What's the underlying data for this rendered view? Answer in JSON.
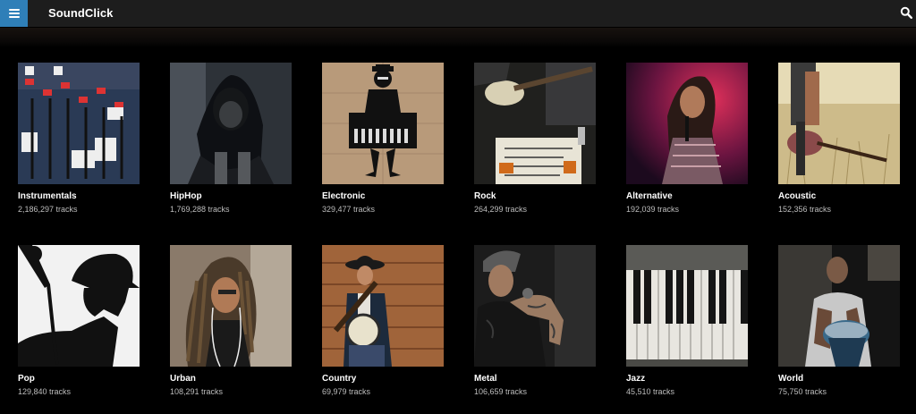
{
  "header": {
    "brand": "SoundClick",
    "menu_icon": "hamburger-menu-icon",
    "search_icon": "search-icon",
    "accent_color": "#2f7fb8"
  },
  "genres": [
    {
      "name": "Instrumentals",
      "count": "2,186,297 tracks",
      "image": "mixing-console"
    },
    {
      "name": "HipHop",
      "count": "1,769,288 tracks",
      "image": "hooded-person"
    },
    {
      "name": "Electronic",
      "count": "329,477 tracks",
      "image": "keyboard-player-stencil"
    },
    {
      "name": "Rock",
      "count": "264,299 tracks",
      "image": "bass-guitar-setlist"
    },
    {
      "name": "Alternative",
      "count": "192,039 tracks",
      "image": "singer-red-light"
    },
    {
      "name": "Acoustic",
      "count": "152,356 tracks",
      "image": "guitar-in-field"
    },
    {
      "name": "Pop",
      "count": "129,840 tracks",
      "image": "singer-silhouette"
    },
    {
      "name": "Urban",
      "count": "108,291 tracks",
      "image": "dreadlocks-earphones"
    },
    {
      "name": "Country",
      "count": "69,979 tracks",
      "image": "banjo-player"
    },
    {
      "name": "Metal",
      "count": "106,659 tracks",
      "image": "tattooed-singer"
    },
    {
      "name": "Jazz",
      "count": "45,510 tracks",
      "image": "piano-keys"
    },
    {
      "name": "World",
      "count": "75,750 tracks",
      "image": "drummer-dark"
    }
  ]
}
